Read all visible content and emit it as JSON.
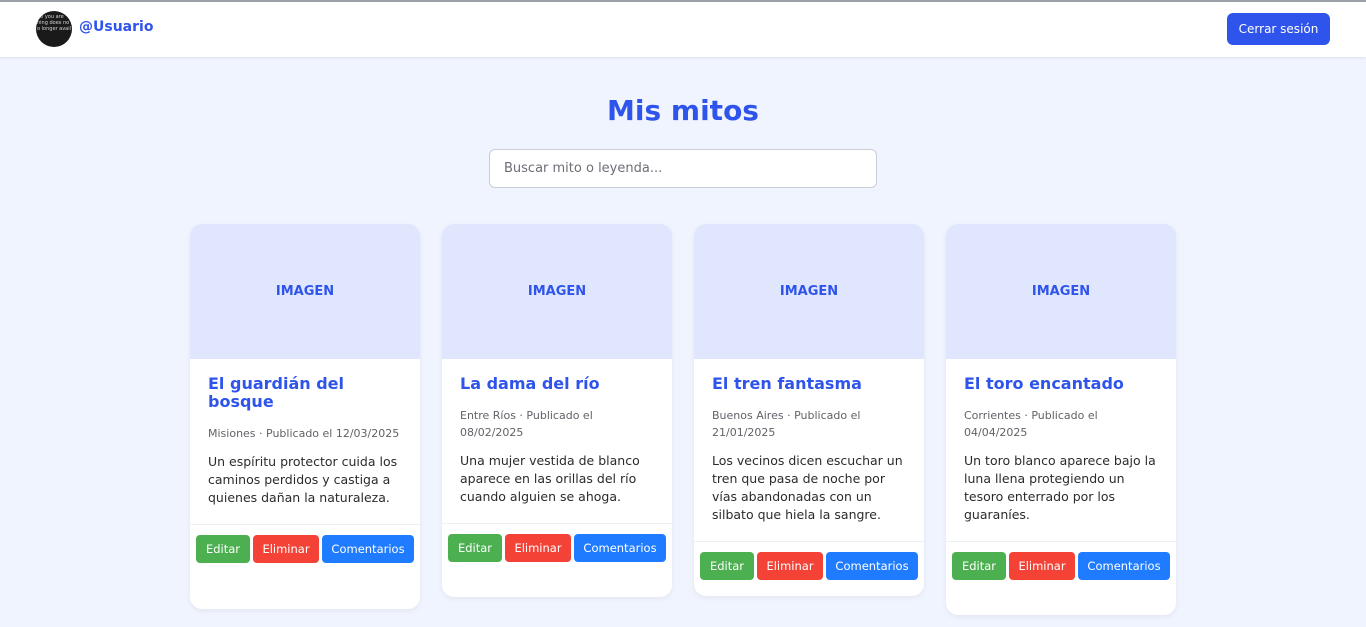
{
  "header": {
    "avatar_text": "ge you are\nhing does no\no longer avail",
    "username": "@Usuario",
    "logout_label": "Cerrar sesión"
  },
  "main": {
    "title": "Mis mitos",
    "search": {
      "placeholder": "Buscar mito o leyenda...",
      "value": ""
    }
  },
  "cards": [
    {
      "image_label": "IMAGEN",
      "title": "El guardián del bosque",
      "meta": "Misiones · Publicado el 12/03/2025",
      "description": "Un espíritu protector cuida los caminos perdidos y castiga a quienes dañan la naturaleza.",
      "edit_label": "Editar",
      "delete_label": "Eliminar",
      "comments_label": "Comentarios"
    },
    {
      "image_label": "IMAGEN",
      "title": "La dama del río",
      "meta": "Entre Ríos · Publicado el 08/02/2025",
      "description": "Una mujer vestida de blanco aparece en las orillas del río cuando alguien se ahoga.",
      "edit_label": "Editar",
      "delete_label": "Eliminar",
      "comments_label": "Comentarios"
    },
    {
      "image_label": "IMAGEN",
      "title": "El tren fantasma",
      "meta": "Buenos Aires · Publicado el 21/01/2025",
      "description": "Los vecinos dicen escuchar un tren que pasa de noche por vías abandonadas con un silbato que hiela la sangre.",
      "edit_label": "Editar",
      "delete_label": "Eliminar",
      "comments_label": "Comentarios"
    },
    {
      "image_label": "IMAGEN",
      "title": "El toro encantado",
      "meta": "Corrientes · Publicado el 04/04/2025",
      "description": "Un toro blanco aparece bajo la luna llena protegiendo un tesoro enterrado por los guaraníes.",
      "edit_label": "Editar",
      "delete_label": "Eliminar",
      "comments_label": "Comentarios"
    }
  ],
  "colors": {
    "accent": "#2f54eb",
    "edit": "#4caf50",
    "delete": "#f44336",
    "comments": "#1f7bff",
    "background": "#f0f4fe",
    "image_placeholder": "#dfe6fd"
  }
}
